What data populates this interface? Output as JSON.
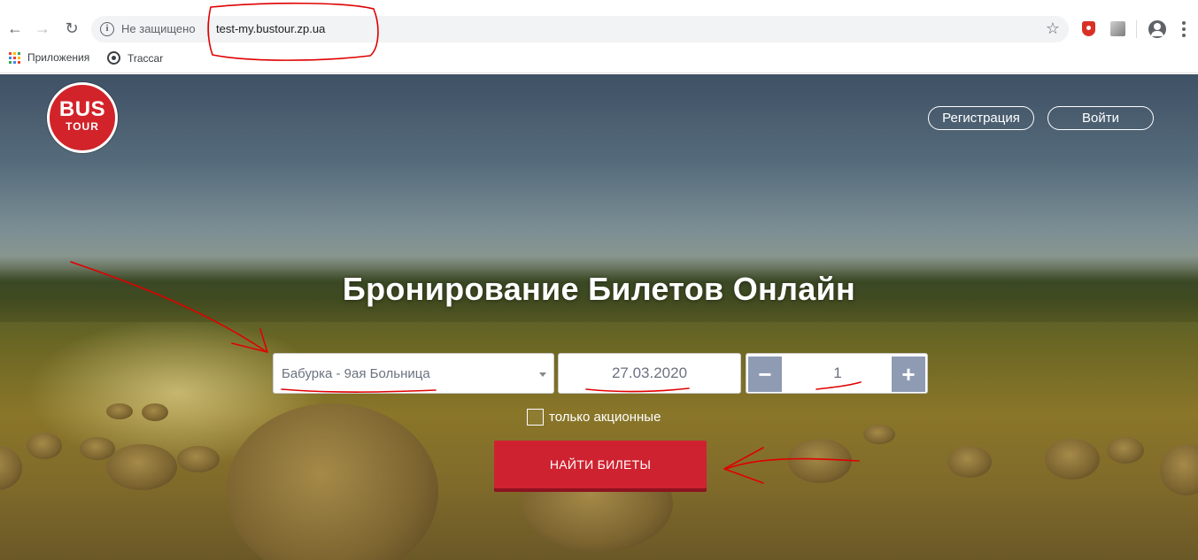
{
  "browser": {
    "security_label": "Не защищено",
    "url": "test-my.bustour.zp.ua",
    "bookmarks": [
      {
        "label": "Приложения",
        "icon": "apps-grid-icon"
      },
      {
        "label": "Traccar",
        "icon": "traccar-icon"
      }
    ]
  },
  "site": {
    "logo": {
      "line1": "BUS",
      "line2": "TOUR"
    },
    "nav": {
      "register": "Регистрация",
      "login": "Войти"
    },
    "hero_title": "Бронирование Билетов Онлайн",
    "form": {
      "route_value": "Бабурка - 9ая Больница",
      "date_value": "27.03.2020",
      "passengers": {
        "minus": "−",
        "value": "1",
        "plus": "+"
      },
      "promo_only_label": "только акционные",
      "promo_only_checked": false,
      "submit_label": "НАЙТИ БИЛЕТЫ"
    }
  },
  "colors": {
    "brand_red": "#d2232a",
    "button_red": "#cf2230",
    "stepper_btn": "#8f9bb3",
    "annotation_red": "#e00000"
  }
}
